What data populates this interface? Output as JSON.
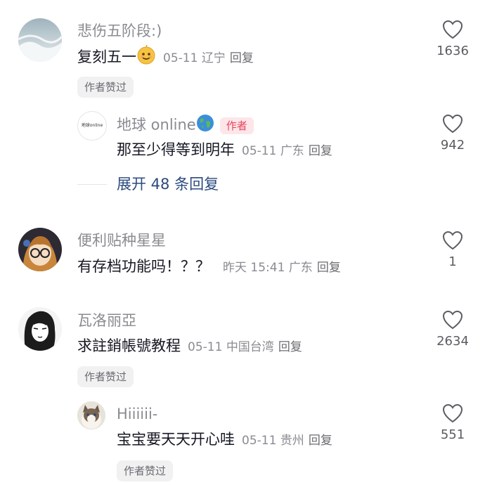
{
  "colors": {
    "username": "#8a8b91",
    "text": "#161823",
    "expand": "#2b4a7d",
    "author_tag_bg": "#fde6ea",
    "author_tag_text": "#e8455a"
  },
  "comments": [
    {
      "username": "悲伤五阶段:)",
      "text": "复刻五一",
      "emoji": "smiling-face-emoji",
      "date": "05-11",
      "location": "辽宁",
      "reply_label": "回复",
      "likes": "1636",
      "liked_badge": "作者赞过",
      "replies": [
        {
          "username": "地球 online",
          "username_icon": "globe-emoji",
          "author_tag": "作者",
          "avatar_text": "地球online",
          "text": "那至少得等到明年",
          "date": "05-11",
          "location": "广东",
          "reply_label": "回复",
          "likes": "942"
        }
      ],
      "expand_label": "展开 48 条回复"
    },
    {
      "username": "便利贴种星星",
      "text": "有存档功能吗！？？",
      "date": "昨天 15:41",
      "location": "广东",
      "reply_label": "回复",
      "likes": "1"
    },
    {
      "username": "瓦洛丽亞",
      "text": "求註銷帳號教程",
      "date": "05-11",
      "location": "中国台湾",
      "reply_label": "回复",
      "likes": "2634",
      "liked_badge": "作者赞过",
      "replies": [
        {
          "username": "Hiiiiii-",
          "text": "宝宝要天天开心哇",
          "date": "05-11",
          "location": "贵州",
          "reply_label": "回复",
          "likes": "551",
          "liked_badge": "作者赞过"
        }
      ]
    }
  ]
}
